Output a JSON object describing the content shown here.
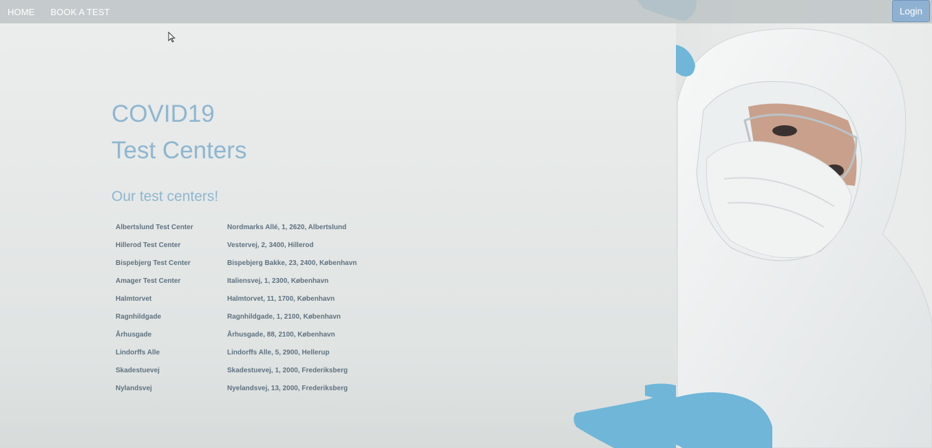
{
  "nav": {
    "home_label": "HOME",
    "book_label": "BOOK A TEST",
    "login_label": "Login"
  },
  "hero": {
    "title_line1": "COVID19",
    "title_line2": "Test Centers",
    "subtitle": "Our test centers!"
  },
  "centers": [
    {
      "name": "Albertslund Test Center",
      "address": "Nordmarks Allé, 1, 2620, Albertslund"
    },
    {
      "name": "Hillerod Test Center",
      "address": "Vestervej, 2, 3400, Hillerod"
    },
    {
      "name": "Bispebjerg Test Center",
      "address": "Bispebjerg Bakke, 23, 2400, København"
    },
    {
      "name": "Amager Test Center",
      "address": "Italiensvej, 1, 2300, København"
    },
    {
      "name": "Halmtorvet",
      "address": "Halmtorvet, 11, 1700, København"
    },
    {
      "name": "Ragnhildgade",
      "address": "Ragnhildgade, 1, 2100, København"
    },
    {
      "name": "Århusgade",
      "address": "Århusgade, 88, 2100, København"
    },
    {
      "name": "Lindorffs Alle",
      "address": "Lindorffs Alle, 5, 2900, Hellerup"
    },
    {
      "name": "Skadestuevej",
      "address": "Skadestuevej, 1, 2000, Frederiksberg"
    },
    {
      "name": "Nylandsvej",
      "address": "Nyelandsvej, 13, 2000, Frederiksberg"
    }
  ],
  "colors": {
    "accent": "#8fb6d0",
    "login_bg": "#8fb1d1",
    "glove": "#6fb6d8"
  }
}
